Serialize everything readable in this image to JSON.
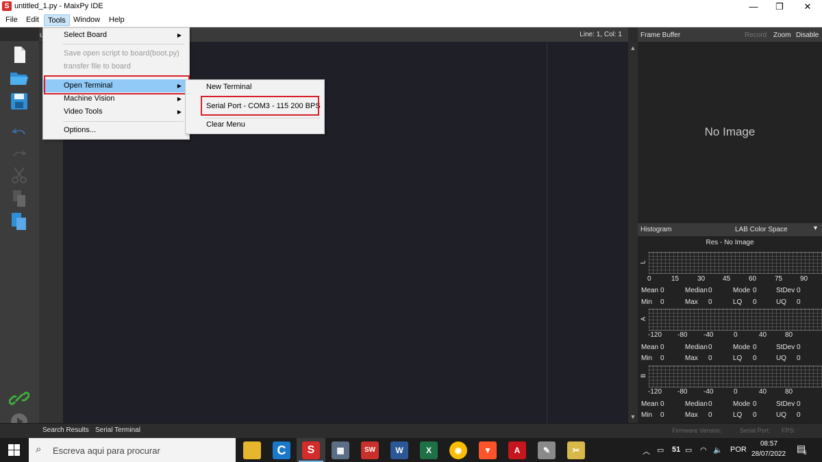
{
  "window": {
    "title": "untitled_1.py - MaixPy IDE",
    "app_icon_letter": "S",
    "minimize": "—",
    "maximize": "❐",
    "close": "✕"
  },
  "menubar": [
    "File",
    "Edit",
    "Tools",
    "Window",
    "Help"
  ],
  "editor": {
    "tab_stub": "u",
    "cursor_pos": "Line: 1, Col: 1"
  },
  "tools_menu": {
    "items": [
      {
        "label": "Select Board",
        "submenu": true,
        "enabled": true
      },
      {
        "label": "Save open script to board(boot.py)",
        "enabled": false
      },
      {
        "label": "transfer file to board",
        "enabled": false
      },
      {
        "label": "Open Terminal",
        "submenu": true,
        "enabled": true,
        "highlighted": true
      },
      {
        "label": "Machine Vision",
        "submenu": true,
        "enabled": true
      },
      {
        "label": "Video Tools",
        "submenu": true,
        "enabled": true
      },
      {
        "label": "Options...",
        "enabled": true
      }
    ]
  },
  "terminal_submenu": {
    "items": [
      "New Terminal",
      "Serial Port - COM3 - 115 200 BPS",
      "Clear Menu"
    ]
  },
  "frame_buffer": {
    "label": "Frame Buffer",
    "record": "Record",
    "zoom": "Zoom",
    "disable": "Disable",
    "placeholder": "No Image"
  },
  "histogram": {
    "label": "Histogram",
    "color_space": "LAB Color Space",
    "resolution": "Res - No Image",
    "channels": [
      {
        "name": "L",
        "ticks": [
          "0",
          "15",
          "30",
          "45",
          "60",
          "75",
          "90"
        ]
      },
      {
        "name": "A",
        "ticks": [
          "-120",
          "-80",
          "-40",
          "0",
          "40",
          "80"
        ]
      },
      {
        "name": "B",
        "ticks": [
          "-120",
          "-80",
          "-40",
          "0",
          "40",
          "80"
        ]
      }
    ],
    "stat_labels": [
      "Mean",
      "Median",
      "Mode",
      "StDev",
      "Min",
      "Max",
      "LQ",
      "UQ"
    ],
    "stat_value": "0"
  },
  "bottom": {
    "tabs": [
      "Search Results",
      "Serial Terminal"
    ],
    "firmware": "Firmware Version:",
    "serial_port": "Serial Port:",
    "fps": "FPS:"
  },
  "taskbar": {
    "search_placeholder": "Escreva aqui para procurar",
    "temperature": "51",
    "language": "POR",
    "time": "08:57",
    "date": "28/07/2022",
    "notifications": "6"
  }
}
